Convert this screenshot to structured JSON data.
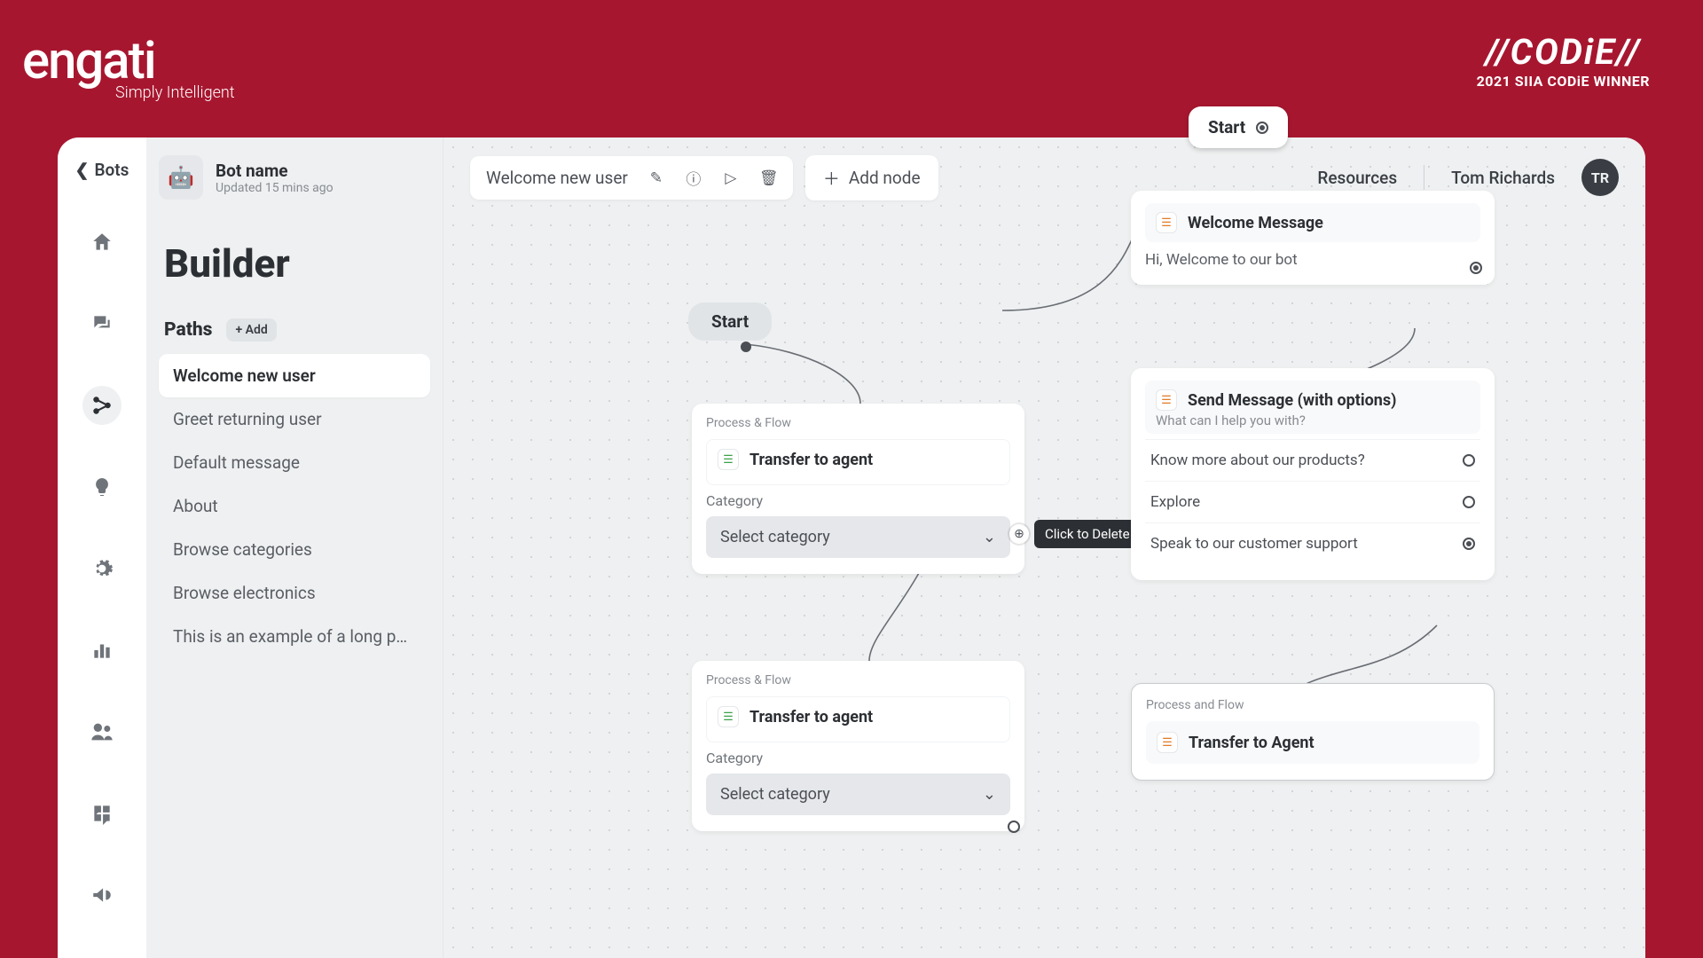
{
  "brand": {
    "name": "engati",
    "tagline": "Simply Intelligent"
  },
  "award": {
    "title": "//CODiE//",
    "subtitle": "2021 SIIA CODiE WINNER"
  },
  "rail": {
    "back_label": "Bots"
  },
  "bot": {
    "name": "Bot name",
    "updated": "Updated 15 mins ago"
  },
  "builder": {
    "title": "Builder"
  },
  "paths": {
    "label": "Paths",
    "add_label": "+ Add",
    "items": [
      "Welcome new user",
      "Greet returning user",
      "Default message",
      "About",
      "Browse categories",
      "Browse electronics",
      "This is an example of a long pa..."
    ]
  },
  "toolbar": {
    "path_name": "Welcome new user",
    "add_node": "Add node"
  },
  "header_right": {
    "resources": "Resources",
    "user_name": "Tom Richards",
    "user_initials": "TR"
  },
  "start_pill": "Start",
  "canvas": {
    "start_label": "Start",
    "section_label": "Process & Flow",
    "transfer_title": "Transfer to agent",
    "category_label": "Category",
    "category_placeholder": "Select category",
    "delete_tooltip": "Click to Delete"
  },
  "right_cards": {
    "welcome": {
      "title": "Welcome Message",
      "text": "Hi, Welcome to our bot"
    },
    "send": {
      "title": "Send Message (with options)",
      "subtitle": "What can I help you with?",
      "options": [
        "Know more about our products?",
        "Explore",
        "Speak to our customer support"
      ]
    },
    "transfer": {
      "section": "Process and Flow",
      "title": "Transfer to Agent"
    }
  }
}
